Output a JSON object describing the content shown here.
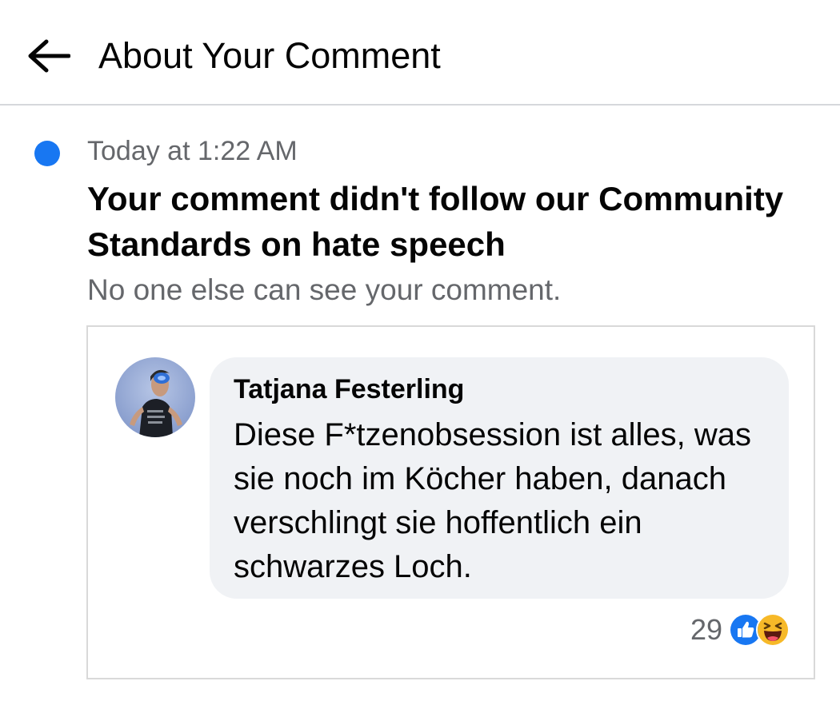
{
  "header": {
    "title": "About Your Comment",
    "back_icon": "arrow-left-icon"
  },
  "notice": {
    "timestamp": "Today at 1:22 AM",
    "headline": "Your comment didn't follow our Community Standards on hate speech",
    "subtext": "No one else can see your comment.",
    "unread_indicator_color": "#1877f2"
  },
  "comment": {
    "author": "Tatjana Festerling",
    "text": "Diese F*tzenobsession ist alles, was sie noch im Köcher haben, danach verschlingt sie hoffentlich ein schwarzes Loch.",
    "reaction_count": "29",
    "reactions": [
      "like-icon",
      "haha-icon"
    ]
  },
  "colors": {
    "accent": "#1877f2",
    "secondary_text": "#65676b",
    "bubble": "#f0f2f5",
    "divider": "#d6d8db",
    "haha_yellow": "#f7b928"
  }
}
